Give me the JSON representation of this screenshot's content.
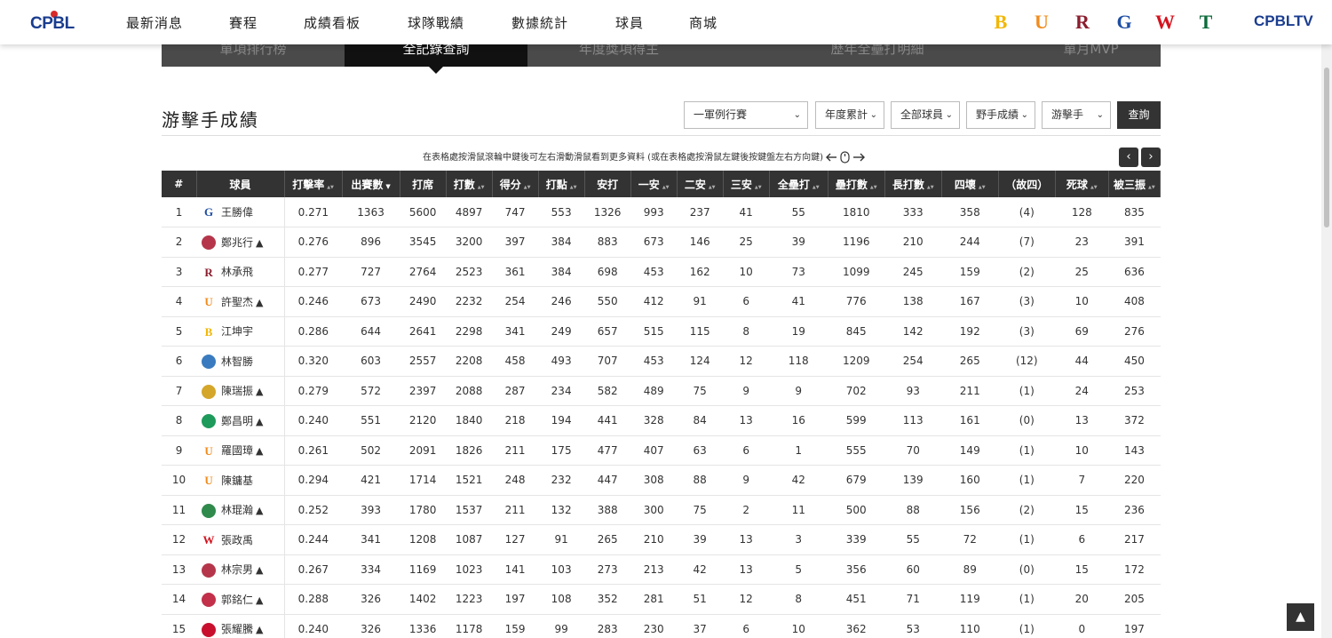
{
  "header": {
    "logo_text": "CPBL",
    "nav": [
      "最新消息",
      "賽程",
      "成績看板",
      "球隊戰績",
      "數據統計",
      "球員",
      "商城"
    ],
    "team_logos": [
      {
        "name": "brothers-logo",
        "glyph": "B",
        "color": "#f2b705"
      },
      {
        "name": "lions-logo",
        "glyph": "U",
        "color": "#f08c1d"
      },
      {
        "name": "rakuten-logo",
        "glyph": "R",
        "color": "#8b1e2e"
      },
      {
        "name": "fubon-logo",
        "glyph": "G",
        "color": "#1f4fa3"
      },
      {
        "name": "wei-chuan-logo",
        "glyph": "W",
        "color": "#d4141f"
      },
      {
        "name": "tsg-logo",
        "glyph": "T",
        "color": "#0c6b3a"
      }
    ],
    "tv_label": "CPBLTV"
  },
  "subtabs": [
    "單項排行榜",
    "全記錄查詢",
    "年度獎項得主",
    "歷年全壘打明細",
    "單月MVP"
  ],
  "active_subtab": 1,
  "title": "游擊手成績",
  "filters": {
    "season_type": "一軍例行賽",
    "period": "年度累計",
    "players": "全部球員",
    "stat_type": "野手成績",
    "position": "游擊手",
    "query_button": "查詢"
  },
  "scroll_hint": "在表格處按滑鼠滾輪中鍵後可左右滑動滑鼠看到更多資料 (或在表格處按滑鼠左鍵後按鍵盤左右方向鍵)",
  "table": {
    "columns": [
      "#",
      "球員",
      "打擊率",
      "出賽數",
      "打席",
      "打數",
      "得分",
      "打點",
      "安打",
      "一安",
      "二安",
      "三安",
      "全壘打",
      "壘打數",
      "長打數",
      "四壞",
      "（故四）",
      "死球",
      "被三振"
    ],
    "sortable": [
      false,
      false,
      true,
      true,
      false,
      true,
      true,
      true,
      false,
      true,
      true,
      true,
      true,
      true,
      true,
      true,
      false,
      true,
      true
    ],
    "rows": [
      {
        "rank": "1",
        "player": "王勝偉",
        "team": "fubon",
        "mark": "",
        "stats": [
          "0.271",
          "1363",
          "5600",
          "4897",
          "747",
          "553",
          "1326",
          "993",
          "237",
          "41",
          "55",
          "1810",
          "333",
          "358",
          "(4)",
          "128",
          "835"
        ]
      },
      {
        "rank": "2",
        "player": "鄭兆行",
        "team": "seal",
        "mark": "▲",
        "stats": [
          "0.276",
          "896",
          "3545",
          "3200",
          "397",
          "384",
          "883",
          "673",
          "146",
          "25",
          "39",
          "1196",
          "210",
          "244",
          "(7)",
          "23",
          "391"
        ]
      },
      {
        "rank": "3",
        "player": "林承飛",
        "team": "rakuten",
        "mark": "",
        "stats": [
          "0.277",
          "727",
          "2764",
          "2523",
          "361",
          "384",
          "698",
          "453",
          "162",
          "10",
          "73",
          "1099",
          "245",
          "159",
          "(2)",
          "25",
          "636"
        ]
      },
      {
        "rank": "4",
        "player": "許聖杰",
        "team": "lions",
        "mark": "▲",
        "stats": [
          "0.246",
          "673",
          "2490",
          "2232",
          "254",
          "246",
          "550",
          "412",
          "91",
          "6",
          "41",
          "776",
          "138",
          "167",
          "(3)",
          "10",
          "408"
        ]
      },
      {
        "rank": "5",
        "player": "江坤宇",
        "team": "brothers",
        "mark": "",
        "stats": [
          "0.286",
          "644",
          "2641",
          "2298",
          "341",
          "249",
          "657",
          "515",
          "115",
          "8",
          "19",
          "845",
          "142",
          "192",
          "(3)",
          "69",
          "276"
        ]
      },
      {
        "rank": "6",
        "player": "林智勝",
        "team": "lamigo",
        "mark": "",
        "stats": [
          "0.320",
          "603",
          "2557",
          "2208",
          "458",
          "493",
          "707",
          "453",
          "124",
          "12",
          "118",
          "1209",
          "254",
          "265",
          "(12)",
          "44",
          "450"
        ]
      },
      {
        "rank": "7",
        "player": "陳瑞振",
        "team": "bears",
        "mark": "▲",
        "stats": [
          "0.279",
          "572",
          "2397",
          "2088",
          "287",
          "234",
          "582",
          "489",
          "75",
          "9",
          "9",
          "702",
          "93",
          "211",
          "(1)",
          "24",
          "253"
        ]
      },
      {
        "rank": "8",
        "player": "鄭昌明",
        "team": "bulls",
        "mark": "▲",
        "stats": [
          "0.240",
          "551",
          "2120",
          "1840",
          "218",
          "194",
          "441",
          "328",
          "84",
          "13",
          "16",
          "599",
          "113",
          "161",
          "(0)",
          "13",
          "372"
        ]
      },
      {
        "rank": "9",
        "player": "羅國璋",
        "team": "lions",
        "mark": "▲",
        "stats": [
          "0.261",
          "502",
          "2091",
          "1826",
          "211",
          "175",
          "477",
          "407",
          "63",
          "6",
          "1",
          "555",
          "70",
          "149",
          "(1)",
          "10",
          "143"
        ]
      },
      {
        "rank": "10",
        "player": "陳鏞基",
        "team": "lions",
        "mark": "",
        "stats": [
          "0.294",
          "421",
          "1714",
          "1521",
          "248",
          "232",
          "447",
          "308",
          "88",
          "9",
          "42",
          "679",
          "139",
          "160",
          "(1)",
          "7",
          "220"
        ]
      },
      {
        "rank": "11",
        "player": "林琨瀚",
        "team": "tigers",
        "mark": "▲",
        "stats": [
          "0.252",
          "393",
          "1780",
          "1537",
          "211",
          "132",
          "388",
          "300",
          "75",
          "2",
          "11",
          "500",
          "88",
          "156",
          "(2)",
          "15",
          "236"
        ]
      },
      {
        "rank": "12",
        "player": "張政禹",
        "team": "wei-chuan",
        "mark": "",
        "stats": [
          "0.244",
          "341",
          "1208",
          "1087",
          "127",
          "91",
          "265",
          "210",
          "39",
          "13",
          "3",
          "339",
          "55",
          "72",
          "(1)",
          "6",
          "217"
        ]
      },
      {
        "rank": "13",
        "player": "林宗男",
        "team": "seal",
        "mark": "▲",
        "stats": [
          "0.267",
          "334",
          "1169",
          "1023",
          "141",
          "103",
          "273",
          "213",
          "42",
          "13",
          "5",
          "356",
          "60",
          "89",
          "(0)",
          "15",
          "172"
        ]
      },
      {
        "rank": "14",
        "player": "郭銘仁",
        "team": "whales",
        "mark": "▲",
        "stats": [
          "0.288",
          "326",
          "1402",
          "1223",
          "197",
          "108",
          "352",
          "281",
          "51",
          "12",
          "8",
          "451",
          "71",
          "119",
          "(1)",
          "20",
          "205"
        ]
      },
      {
        "rank": "15",
        "player": "張耀騰",
        "team": "dragons",
        "mark": "▲",
        "stats": [
          "0.240",
          "326",
          "1336",
          "1178",
          "159",
          "99",
          "283",
          "230",
          "37",
          "6",
          "10",
          "362",
          "53",
          "110",
          "(1)",
          "0",
          "197"
        ]
      }
    ]
  },
  "colors": {
    "header_dark": "#333333",
    "nav_bar": "#4a4a4a",
    "active_tab": "#111111",
    "brand_blue": "#1a3d8f",
    "brand_green": "#16a05a",
    "brand_red": "#d92a2a"
  }
}
